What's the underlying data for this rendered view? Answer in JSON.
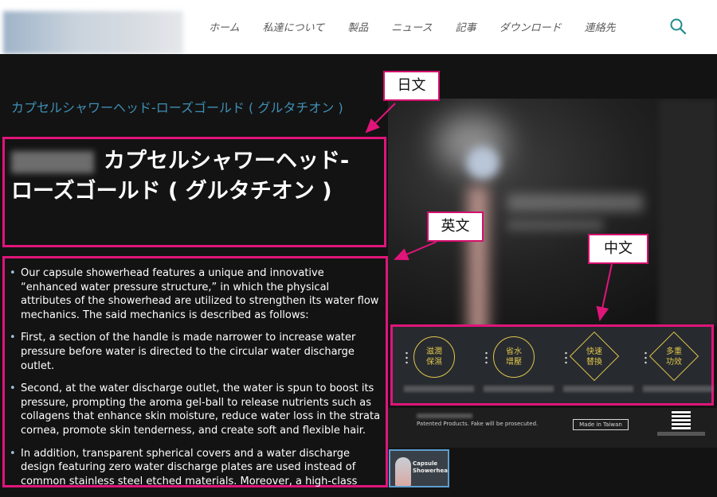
{
  "header": {
    "nav": [
      "ホーム",
      "私達について",
      "製品",
      "ニュース",
      "記事",
      "ダウンロード",
      "連絡先"
    ],
    "search_icon": "search-icon"
  },
  "breadcrumb": "カプセルシャワーヘッド-ローズゴールド ( グルタチオン )",
  "product_title": "カプセルシャワーヘッド-ローズゴールド ( グルタチオン )",
  "description": [
    "Our capsule showerhead features a unique and innovative “enhanced water pressure structure,” in which the physical attributes of the showerhead are utilized to strengthen its water flow mechanics. The said mechanics is described as follows:",
    "First, a section of the handle is made narrower to increase water pressure before water is directed to the circular water discharge outlet.",
    "Second, at the water discharge outlet, the water is spun to boost its pressure, prompting the aroma gel-ball to release nutrients such as collagens that enhance skin moisture, reduce water loss in the strata cornea, promote skin tenderness, and create soft and flexible hair.",
    "In addition, transparent spherical covers and a water discharge design featuring zero water discharge plates are used instead of common stainless steel etched materials. Moreover, a high-class"
  ],
  "features": [
    {
      "text": "滋潤\n保濕",
      "shape": "circle"
    },
    {
      "text": "省水\n增壓",
      "shape": "circle"
    },
    {
      "text": "快速\n替換",
      "shape": "diamond"
    },
    {
      "text": "多重\n功效",
      "shape": "diamond"
    }
  ],
  "patent_text": "Patented Products.  Fake will be prosecuted.",
  "made_in": "Made in Taiwan",
  "thumbnail_caption": "Capsule\nShowerhead",
  "annotations": {
    "japanese": "日文",
    "english": "英文",
    "chinese": "中文"
  },
  "colors": {
    "annotation": "#e0157a",
    "breadcrumb": "#3f8fb5",
    "feature_gold": "#e1c54a"
  }
}
